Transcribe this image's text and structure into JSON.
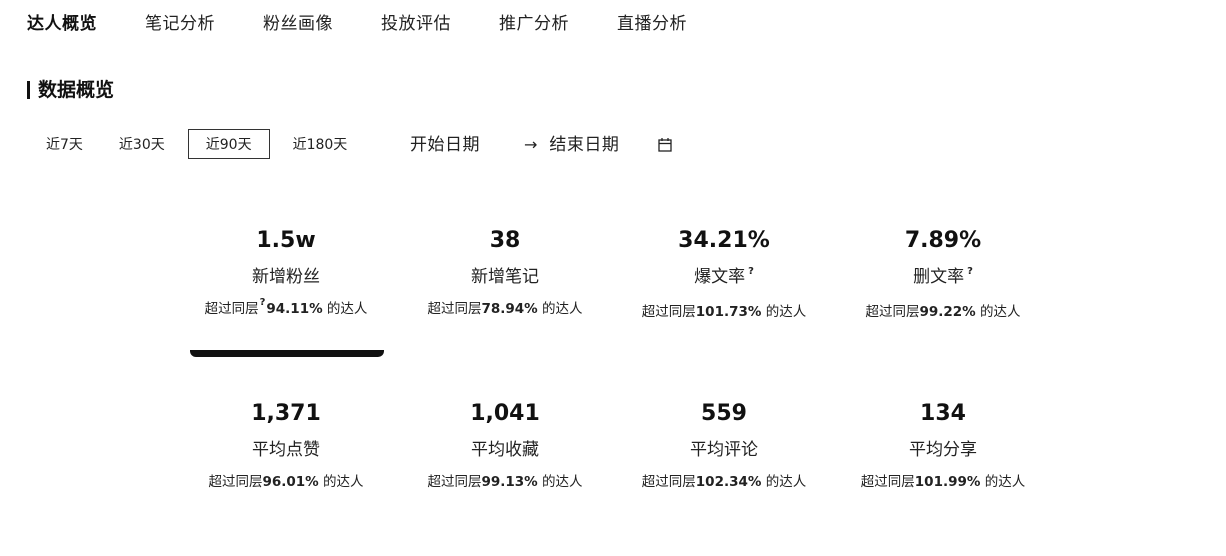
{
  "tabs": [
    "达人概览",
    "笔记分析",
    "粉丝画像",
    "投放评估",
    "推广分析",
    "直播分析"
  ],
  "section_title": "数据概览",
  "ranges": [
    "近7天",
    "近30天",
    "近90天",
    "近180天"
  ],
  "active_range": "近90天",
  "date": {
    "start": "开始日期",
    "arrow": "→",
    "end": "结束日期"
  },
  "stats": [
    {
      "value": "1.5w",
      "label": "新增粉丝",
      "prefix": "超过同层",
      "percent": "94.11%",
      "suffix": " 的达人",
      "help": "?"
    },
    {
      "value": "38",
      "label": "新增笔记",
      "prefix": "超过同层",
      "percent": "78.94%",
      "suffix": " 的达人"
    },
    {
      "value": "34.21%",
      "label": "爆文率",
      "prefix": "超过同层",
      "percent": "101.73%",
      "suffix": " 的达人",
      "help": "?"
    },
    {
      "value": "7.89%",
      "label": "删文率",
      "prefix": "超过同层",
      "percent": "99.22%",
      "suffix": " 的达人",
      "help": "?"
    },
    {
      "value": "1,371",
      "label": "平均点赞",
      "prefix": "超过同层",
      "percent": "96.01%",
      "suffix": " 的达人"
    },
    {
      "value": "1,041",
      "label": "平均收藏",
      "prefix": "超过同层",
      "percent": "99.13%",
      "suffix": " 的达人"
    },
    {
      "value": "559",
      "label": "平均评论",
      "prefix": "超过同层",
      "percent": "102.34%",
      "suffix": " 的达人"
    },
    {
      "value": "134",
      "label": "平均分享",
      "prefix": "超过同层",
      "percent": "101.99%",
      "suffix": " 的达人"
    }
  ]
}
